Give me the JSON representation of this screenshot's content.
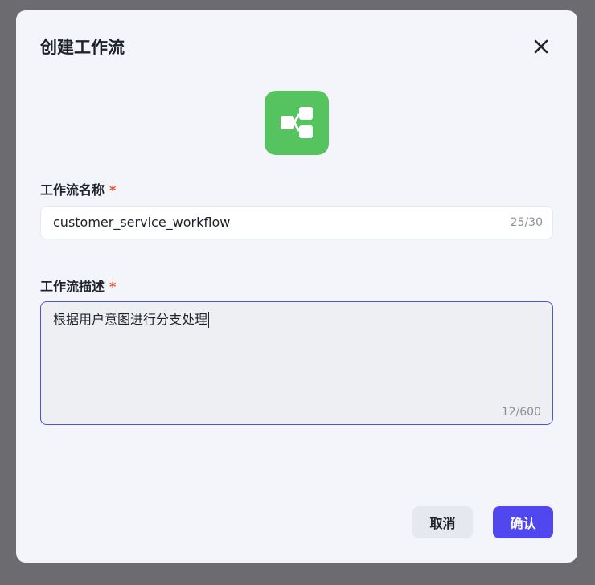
{
  "dialog": {
    "title": "创建工作流",
    "icon": "workflow-icon",
    "accent_color": "#55c35e"
  },
  "name_field": {
    "label": "工作流名称",
    "required_mark": "*",
    "value": "customer_service_workflow",
    "counter": "25/30"
  },
  "description_field": {
    "label": "工作流描述",
    "required_mark": "*",
    "value": "根据用户意图进行分支处理",
    "counter": "12/600"
  },
  "actions": {
    "cancel_label": "取消",
    "confirm_label": "确认",
    "confirm_color": "#5147ee"
  }
}
